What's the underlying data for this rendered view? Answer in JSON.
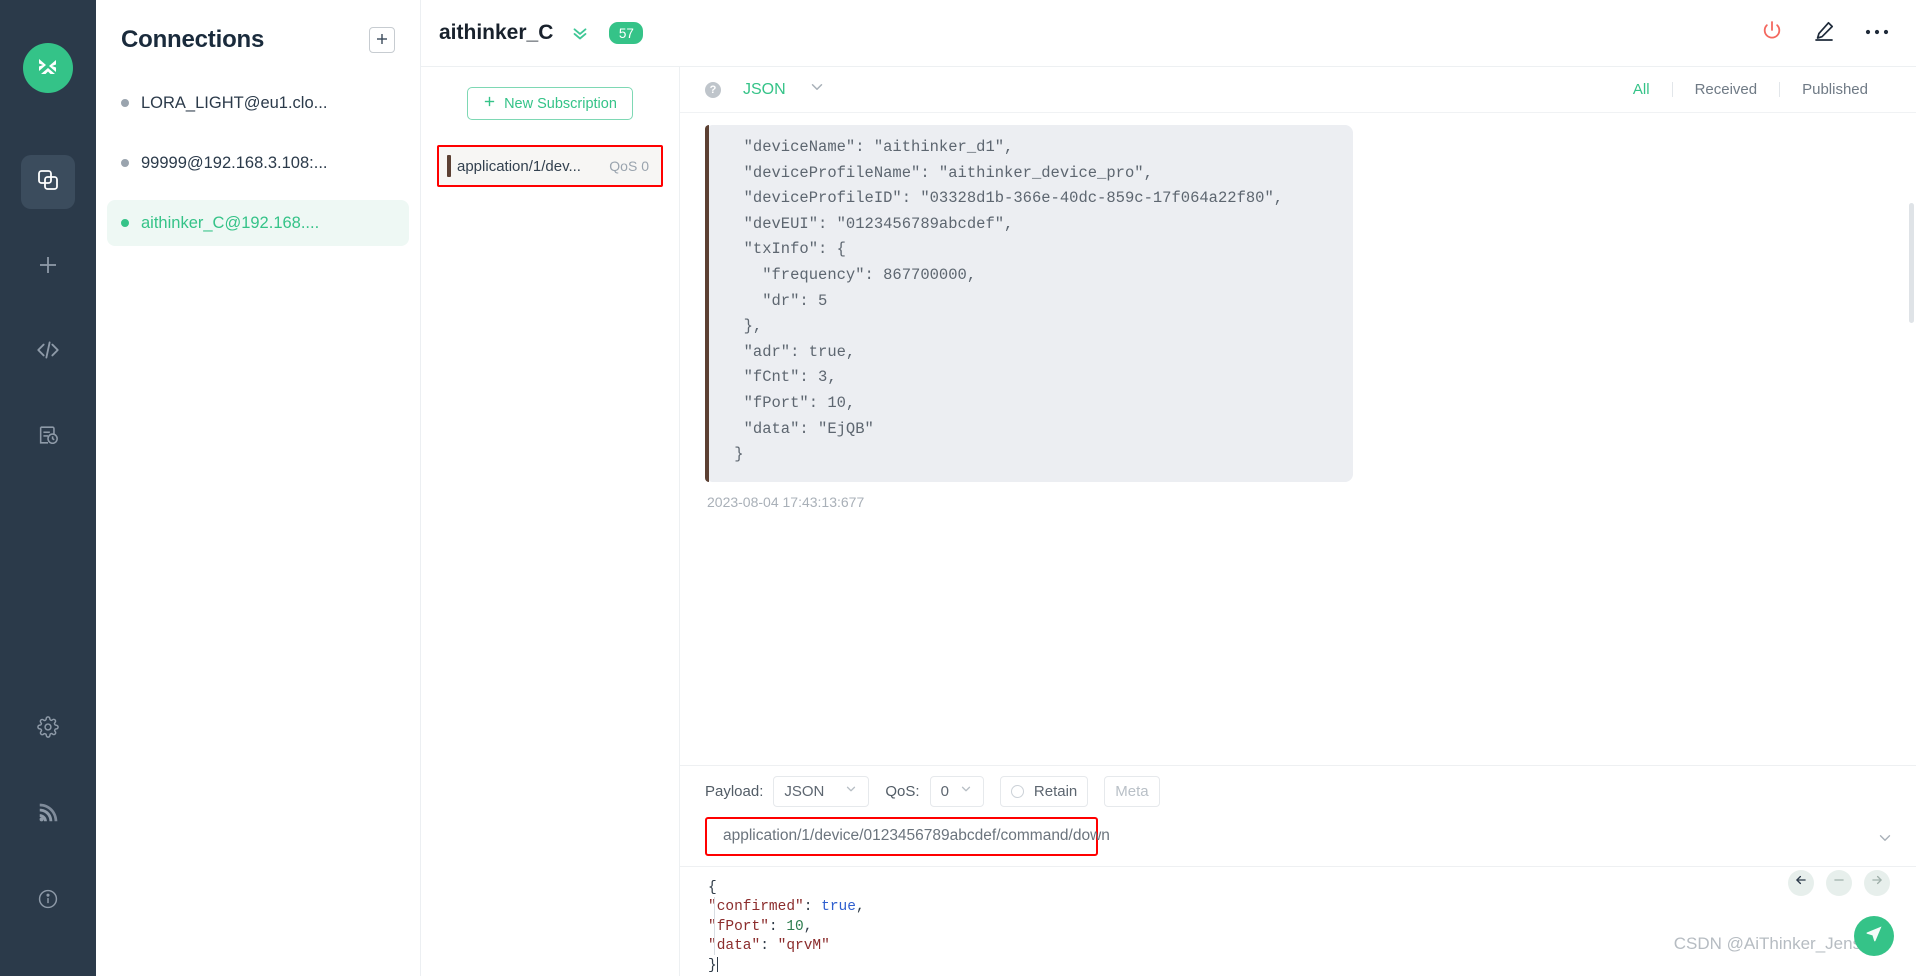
{
  "colors": {
    "accent_green": "#35c388",
    "rail_bg": "#2b3a4a",
    "highlight_red": "#ff0000",
    "power_red": "#f4685f"
  },
  "rail": {
    "logo_icon": "mqttx-logo-icon",
    "top_items": [
      {
        "icon": "connections-icon",
        "name": "rail-item-connections",
        "active": true
      },
      {
        "icon": "plus-icon",
        "name": "rail-item-new-connection",
        "active": false
      },
      {
        "icon": "code-icon",
        "name": "rail-item-scripts",
        "active": false
      },
      {
        "icon": "log-clock-icon",
        "name": "rail-item-log",
        "active": false
      }
    ],
    "bottom_items": [
      {
        "icon": "gear-icon",
        "name": "rail-item-settings"
      },
      {
        "icon": "signal-icon",
        "name": "rail-item-broker"
      },
      {
        "icon": "info-icon",
        "name": "rail-item-about"
      }
    ]
  },
  "connections": {
    "title": "Connections",
    "add_label": "+",
    "items": [
      {
        "label": "LORA_LIGHT@eu1.clo...",
        "status": "offline"
      },
      {
        "label": "99999@192.168.3.108:...",
        "status": "offline"
      },
      {
        "label": "aithinker_C@192.168....",
        "status": "online"
      }
    ]
  },
  "topbar": {
    "title": "aithinker_C",
    "chevron_icon": "chevron-double-down-icon",
    "message_count": "57",
    "actions": [
      {
        "icon": "power-icon",
        "name": "disconnect-button"
      },
      {
        "icon": "pencil-icon",
        "name": "edit-connection-button"
      },
      {
        "icon": "ellipsis-icon",
        "name": "more-options-button"
      }
    ]
  },
  "subscriptions": {
    "new_button_label": "New Subscription",
    "new_button_icon": "plus-icon",
    "items": [
      {
        "topic": "application/1/dev...",
        "qos": "QoS 0",
        "highlighted": true
      }
    ]
  },
  "messages_toolbar": {
    "help_icon": "question-mark-icon",
    "format": "JSON",
    "format_chevron_icon": "chevron-down-icon",
    "filters": [
      {
        "label": "All",
        "active": true
      },
      {
        "label": "Received",
        "active": false
      },
      {
        "label": "Published",
        "active": false
      }
    ]
  },
  "message": {
    "payload_lines": [
      "  \"deviceName\": \"aithinker_d1\",",
      "  \"deviceProfileName\": \"aithinker_device_pro\",",
      "  \"deviceProfileID\": \"03328d1b-366e-40dc-859c-17f064a22f80\",",
      "  \"devEUI\": \"0123456789abcdef\",",
      "  \"txInfo\": {",
      "    \"frequency\": 867700000,",
      "    \"dr\": 5",
      "  },",
      "  \"adr\": true,",
      "  \"fCnt\": 3,",
      "  \"fPort\": 10,",
      "  \"data\": \"EjQB\"",
      " }"
    ],
    "timestamp": "2023-08-04 17:43:13:677"
  },
  "compose": {
    "payload_label": "Payload:",
    "payload_value": "JSON",
    "qos_label": "QoS:",
    "qos_value": "0",
    "retain_label": "Retain",
    "retain_checked": false,
    "meta_label": "Meta",
    "topic_value": "application/1/device/0123456789abcdef/command/down",
    "topic_chevron_icon": "chevron-down-icon",
    "editor": {
      "line1": "{",
      "line2_key": "\"confirmed\"",
      "line2_sep": ": ",
      "line2_val": "true",
      "line2_end": ",",
      "line3_key": "\"fPort\"",
      "line3_sep": ": ",
      "line3_val": "10",
      "line3_end": ",",
      "line4_key": "\"data\"",
      "line4_sep": ": ",
      "line4_val": "\"qrvM\"",
      "line5": "}"
    },
    "nav_buttons": [
      {
        "icon": "arrow-left-icon",
        "name": "history-prev-button"
      },
      {
        "icon": "minus-icon",
        "name": "history-clear-button"
      },
      {
        "icon": "arrow-right-icon",
        "name": "history-next-button"
      }
    ],
    "send_icon": "send-icon"
  },
  "watermark": "CSDN @AiThinker_Jenson"
}
